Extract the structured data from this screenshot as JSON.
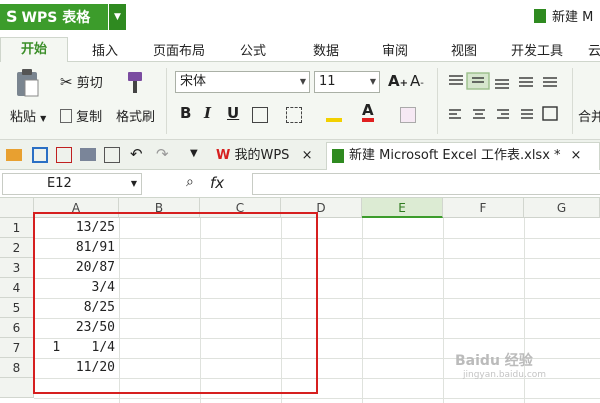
{
  "app": {
    "name": "WPS 表格",
    "logo": "S",
    "doc_title": "新建 M"
  },
  "ribbon_tabs": [
    "开始",
    "插入",
    "页面布局",
    "公式",
    "数据",
    "审阅",
    "视图",
    "开发工具",
    "云"
  ],
  "ribbon": {
    "cut": "剪切",
    "paste": "粘贴",
    "copy": "复制",
    "format_painter": "格式刷",
    "font_name": "宋体",
    "font_size": "11",
    "bold": "B",
    "italic": "I",
    "underline": "U",
    "merge": "合并"
  },
  "doc_tabs": {
    "wps": "我的WPS",
    "excel": "新建 Microsoft Excel 工作表.xlsx *",
    "close": "×"
  },
  "formula_bar": {
    "name_box": "E12",
    "fx": "fx"
  },
  "columns": [
    "A",
    "B",
    "C",
    "D",
    "E",
    "F",
    "G"
  ],
  "selected_column": "E",
  "rows": [
    "1",
    "2",
    "3",
    "4",
    "5",
    "6",
    "7",
    "8"
  ],
  "cells_a": [
    "13/25",
    "81/91",
    "20/87",
    "3/4",
    "8/25",
    "23/50",
    "1    1/4",
    "11/20"
  ],
  "watermark": {
    "main": "Baidu 经验",
    "sub": "jingyan.baidu.com"
  },
  "colors": {
    "accent": "#3c9c2b",
    "highlight": "#d61f1f"
  }
}
